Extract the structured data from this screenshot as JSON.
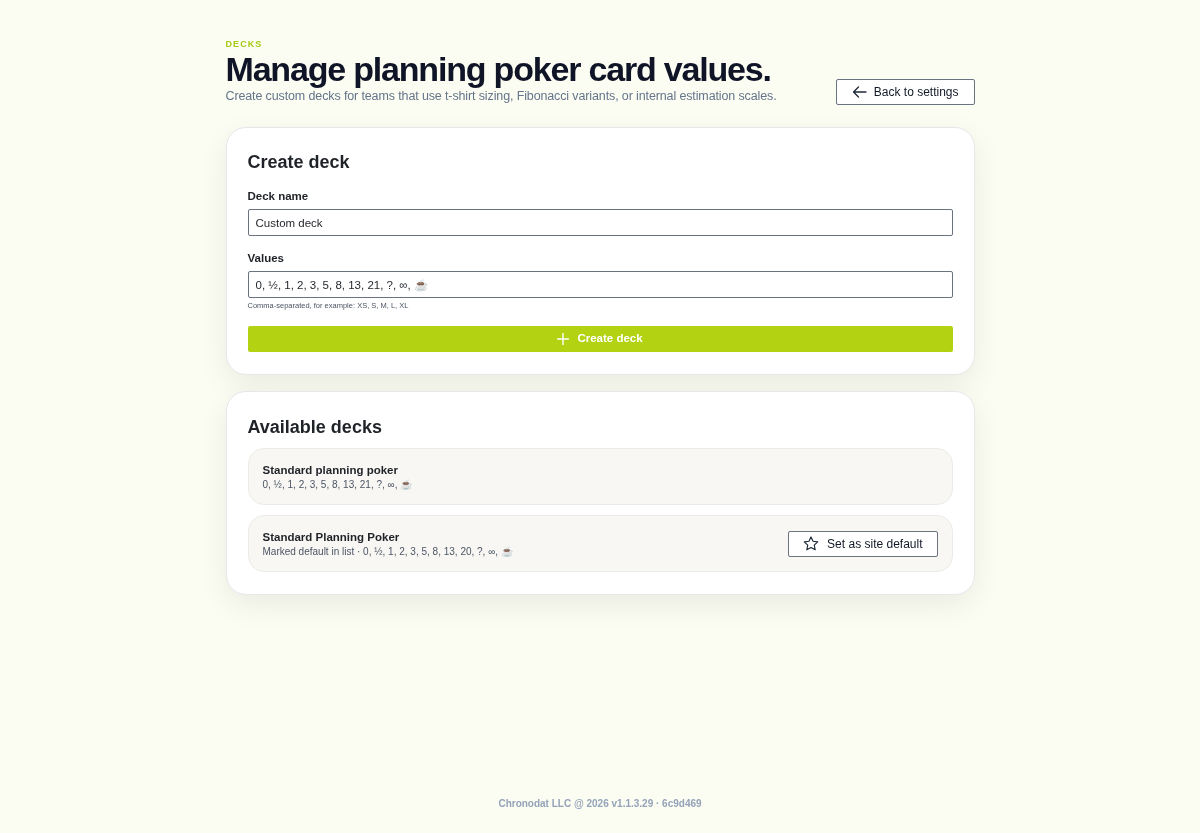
{
  "header": {
    "eyebrow": "DECKS",
    "title": "Manage planning poker card values.",
    "subtitle": "Create custom decks for teams that use t-shirt sizing, Fibonacci variants, or internal estimation scales.",
    "back_button": "Back to settings"
  },
  "create_deck": {
    "title": "Create deck",
    "fields": [
      {
        "label": "Deck name",
        "value": "Custom deck"
      },
      {
        "label": "Values",
        "value": "0, ½, 1, 2, 3, 5, 8, 13, 21, ?, ∞, ☕",
        "hint": "Comma-separated, for example: XS, S, M, L, XL"
      }
    ],
    "submit_button": "Create deck"
  },
  "available_decks": {
    "title": "Available decks",
    "decks": [
      {
        "name": "Standard planning poker",
        "summary": "0, ½, 1, 2, 3, 5, 8, 13, 21, ?, ∞, ☕"
      },
      {
        "name": "Standard Planning Poker",
        "summary": "Marked default in list · 0, ½, 1, 2, 3, 5, 8, 13, 20, ?, ∞, ☕",
        "action_button": "Set as site default"
      }
    ]
  },
  "footer": "Chronodat LLC @ 2026 v1.1.3.29 · 6c9d469"
}
